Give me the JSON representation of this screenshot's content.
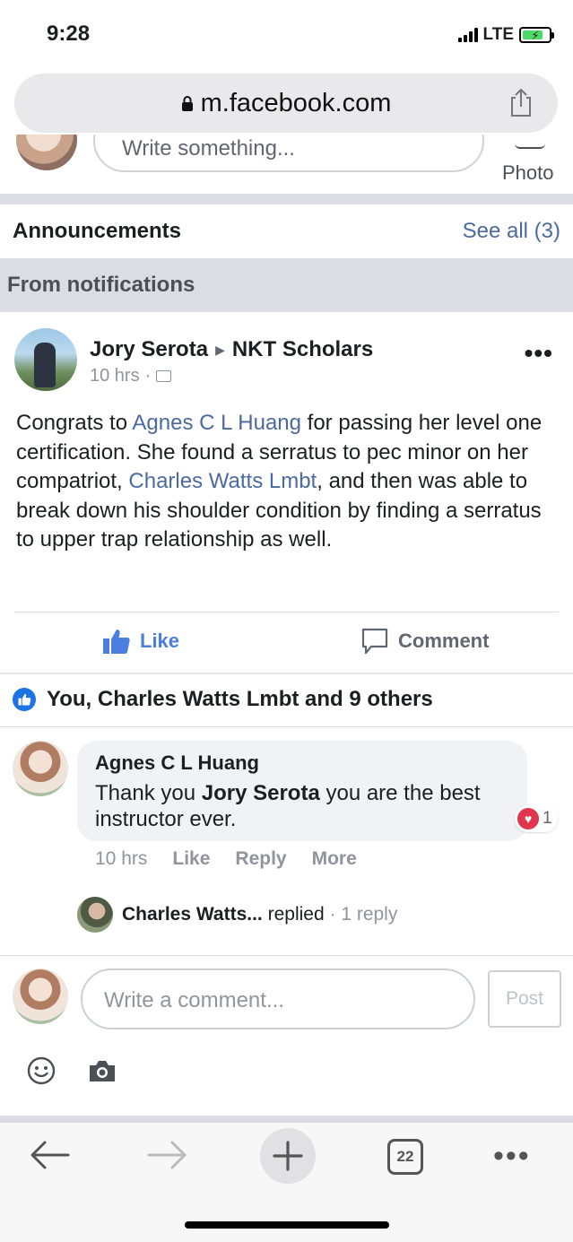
{
  "status_bar": {
    "time": "9:28",
    "network": "LTE"
  },
  "browser": {
    "url": "m.facebook.com"
  },
  "composer": {
    "placeholder": "Write something...",
    "photo_label": "Photo"
  },
  "announcements": {
    "title": "Announcements",
    "see_all": "See all (3)"
  },
  "section": {
    "from_notifications": "From notifications"
  },
  "post": {
    "author": "Jory Serota",
    "group": "NKT Scholars",
    "time": "10 hrs",
    "body_segments": [
      "Congrats to ",
      "Agnes C L Huang",
      " for passing her level one certification. She found a serratus to pec minor on her compatriot, ",
      "Charles Watts Lmbt",
      ", and then was able to break down his shoulder condition by finding a serratus to upper trap relationship as well."
    ],
    "like_label": "Like",
    "comment_label": "Comment"
  },
  "reactions": {
    "summary": "You, Charles Watts Lmbt and 9 others"
  },
  "comment": {
    "author": "Agnes C L Huang",
    "text_before": "Thank you ",
    "mention": "Jory Serota",
    "text_after": " you are the best instructor ever.",
    "reaction_count": "1",
    "time": "10 hrs",
    "actions": [
      "Like",
      "Reply",
      "More"
    ],
    "reply_preview": {
      "name": "Charles Watts...",
      "verb": " replied",
      "count": " · 1 reply"
    }
  },
  "write_comment": {
    "placeholder": "Write a comment...",
    "post_label": "Post"
  },
  "toolbar": {
    "tab_count": "22"
  },
  "colors": {
    "link": "#4b6aa2",
    "like_blue": "#4a7ee0",
    "heart_red": "#e0364d",
    "divider": "#dadde1"
  }
}
